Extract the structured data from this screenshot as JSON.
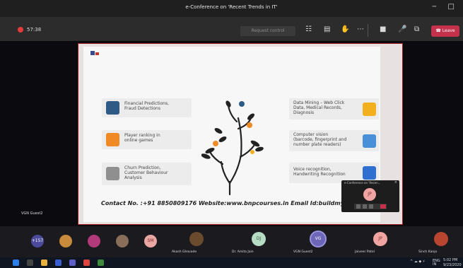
{
  "window": {
    "title": "e-Conference on 'Recent Trends in IT'"
  },
  "toolbar": {
    "timer": "57:38",
    "request_control": "Request control",
    "leave": "Leave",
    "icons": [
      "participants-icon",
      "chat-icon",
      "raise-hand-icon",
      "more-icon",
      "camera-icon",
      "mic-icon",
      "share-icon"
    ]
  },
  "slide": {
    "cards_left": [
      {
        "text": "Financial Predictions,\nFraud Detections",
        "icon_color": "#2e5b86"
      },
      {
        "text": "Player ranking in\nonline games",
        "icon_color": "#f08a24"
      },
      {
        "text": "Churn Prediction,\nCustomer Behaviour\nAnalysis",
        "icon_color": "#8f8f8f"
      }
    ],
    "cards_right": [
      {
        "text": "Data Mining – Web Click\nData, Medical Records,\nDiagnosis",
        "icon_color": "#f2b01f"
      },
      {
        "text": "Computer vision\n(barcode, fingerprint and\nnumber plate readers)",
        "icon_color": "#4a90d9"
      },
      {
        "text": "Voice recognition,\nHandwriting Recognition",
        "icon_color": "#2f6fcf"
      }
    ],
    "footer": "Contact No. :+91 8850809176  Website:www.bnpcourses.in  Email Id:buildmyprojects@"
  },
  "self_view": {
    "title": "e-Conference on 'Recen...",
    "initials": "JP"
  },
  "speaker_label": "VGN Guest2",
  "participants": [
    {
      "initials": "+157",
      "color": "#4c4a9a"
    },
    {
      "initials": "",
      "color": "#c88a3b"
    },
    {
      "initials": "",
      "color": "#b23a7a"
    },
    {
      "initials": "",
      "color": "#8a6e5a"
    },
    {
      "initials": "SM",
      "color": "#e9a6a2"
    }
  ],
  "tiles": [
    {
      "name": "Akash Ghavade",
      "initials": "",
      "color": "#6a4b2d"
    },
    {
      "name": "Dr. Amita Jain",
      "initials": "DJ",
      "color": "#b7dcc6"
    },
    {
      "name": "VGN Guest2",
      "initials": "VG",
      "color": "#6c65b8"
    },
    {
      "name": "Jaiveer Patel",
      "initials": "JP",
      "color": "#f0a5a2"
    },
    {
      "name": "Sinch Kanjo",
      "initials": "",
      "color": "#b8452f"
    }
  ],
  "taskbar": {
    "time": "5:02 PM",
    "date": "9/23/2020",
    "lang": "ENG\nIN"
  }
}
